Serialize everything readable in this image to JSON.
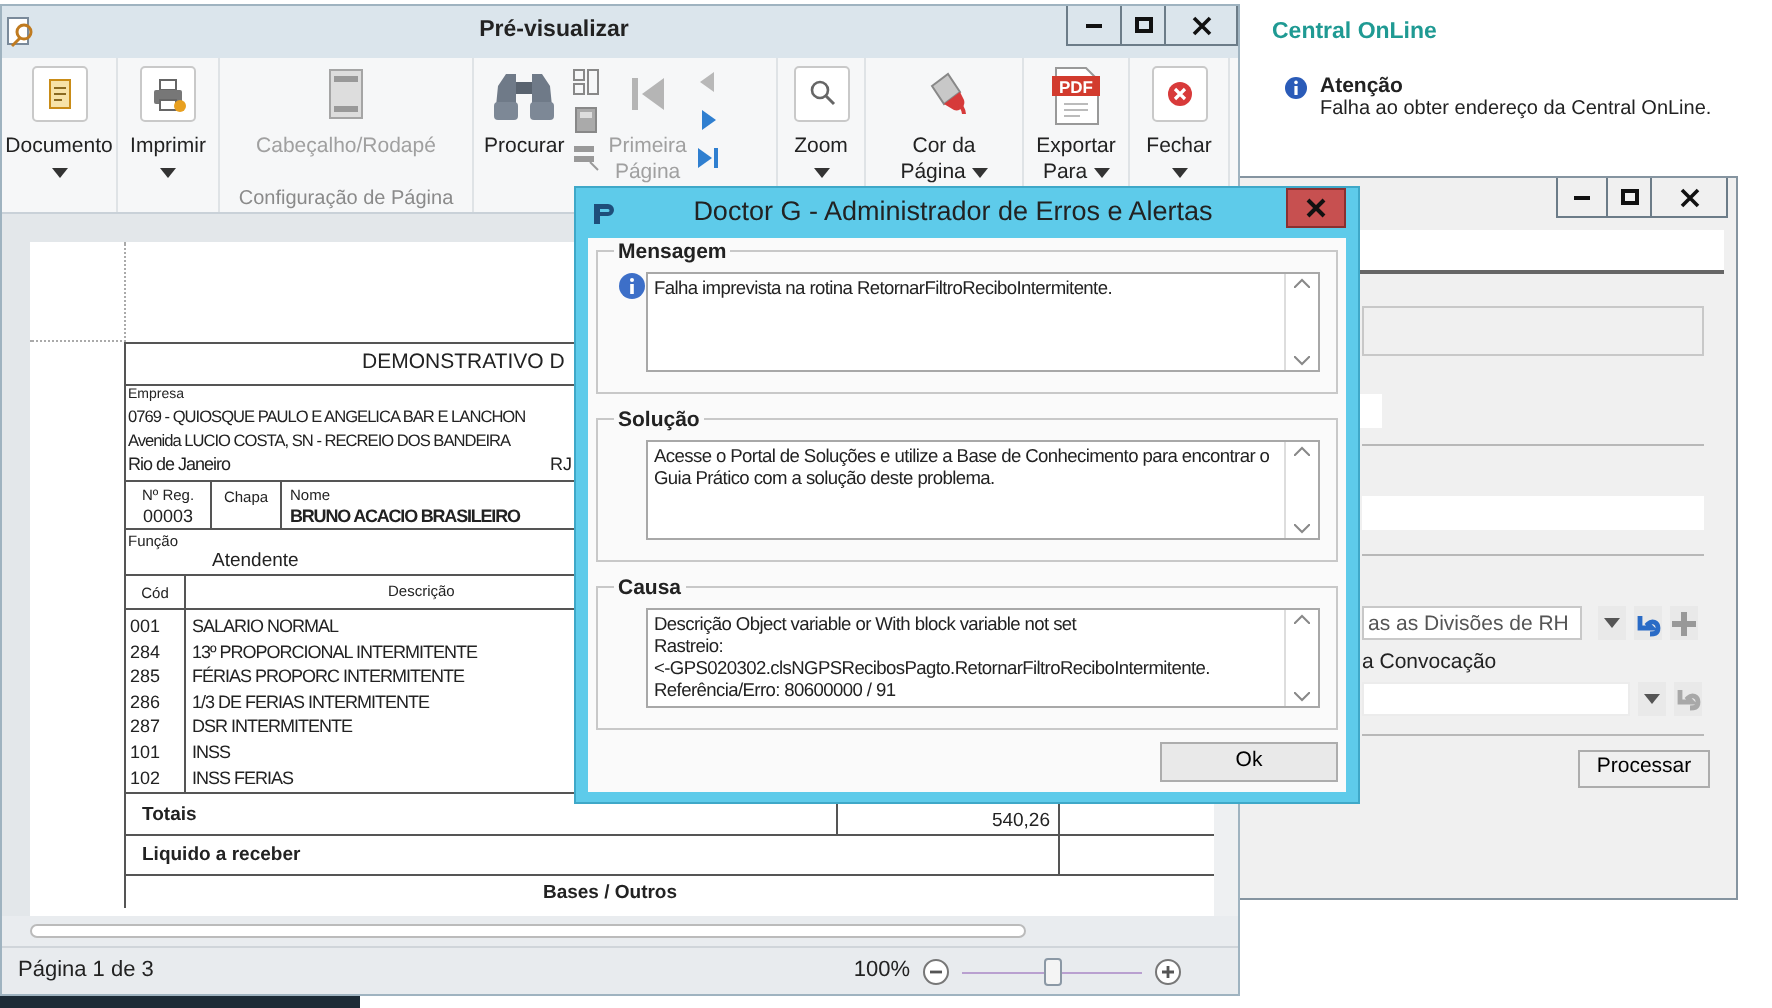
{
  "preview_window": {
    "title": "Pré-visualizar",
    "ribbon": [
      {
        "items": [
          {
            "kind": "document",
            "label": "Documento",
            "disabled": false,
            "dropdown": true
          }
        ]
      },
      {
        "items": [
          {
            "kind": "print",
            "label": "Imprimir",
            "disabled": false,
            "dropdown": true
          }
        ]
      },
      {
        "caption": "Configuração de Página",
        "items": [
          {
            "kind": "header",
            "label": "Cabeçalho/Rodapé",
            "disabled": true,
            "dropdown": false
          }
        ]
      },
      {
        "items": [
          {
            "kind": "find",
            "label": "Procurar",
            "disabled": false,
            "dropdown": false
          },
          {
            "kind": "stack",
            "buttons": [
              {
                "kind": "thumbnails"
              },
              {
                "kind": "bookmark"
              },
              {
                "kind": "multipage"
              }
            ]
          },
          {
            "kind": "first",
            "label": "Primeira Página",
            "disabled": true,
            "dropdown": false
          },
          {
            "kind": "stack",
            "buttons": [
              {
                "kind": "prev",
                "disabled": true
              },
              {
                "kind": "next",
                "disabled": false
              },
              {
                "kind": "last",
                "disabled": false
              }
            ]
          }
        ]
      },
      {
        "items": [
          {
            "kind": "zoom",
            "label": "Zoom",
            "disabled": false,
            "dropdown": true
          }
        ]
      },
      {
        "items": [
          {
            "kind": "color",
            "label": "Cor da Página",
            "disabled": false,
            "dropdown": true
          }
        ]
      },
      {
        "items": [
          {
            "kind": "export",
            "label": "Exportar Para",
            "icon_text": "PDF",
            "disabled": false,
            "dropdown": true
          }
        ]
      },
      {
        "items": [
          {
            "kind": "close",
            "label": "Fechar",
            "disabled": false,
            "dropdown": true
          }
        ]
      }
    ],
    "document": {
      "title": "DEMONSTRATIVO D",
      "company_label": "Empresa",
      "company_lines": [
        "0769 - QUIOSQUE PAULO E ANGELICA BAR E LANCHON",
        "Avenida LUCIO COSTA, SN - RECREIO DOS BANDEIRA",
        "Rio de Janeiro"
      ],
      "state": "RJ",
      "reg_label": "Nº Reg.",
      "reg": "00003",
      "chapa_label": "Chapa",
      "name_label": "Nome",
      "name": "BRUNO ACACIO BRASILEIRO",
      "function_label": "Função",
      "function": "Atendente",
      "columns": [
        "Cód",
        "Descrição"
      ],
      "rows": [
        {
          "code": "001",
          "description": "SALARIO  NORMAL"
        },
        {
          "code": "284",
          "description": "13º PROPORCIONAL INTERMITENTE"
        },
        {
          "code": "285",
          "description": "FÉRIAS PROPORC INTERMITENTE"
        },
        {
          "code": "286",
          "description": "1/3 DE FERIAS INTERMITENTE"
        },
        {
          "code": "287",
          "description": "DSR INTERMITENTE"
        },
        {
          "code": "101",
          "description": "INSS"
        },
        {
          "code": "102",
          "description": "INSS FERIAS"
        }
      ],
      "totals_label": "Totais",
      "total_earnings": "540,26",
      "net_label": "Liquido a receber",
      "bases_title": "Bases / Outros"
    },
    "status_bar": {
      "page": "Página 1 de 3",
      "zoom": "100%",
      "zoom_slider": {
        "level": 0.5
      }
    }
  },
  "notification": {
    "title": "Central OnLine",
    "heading": "Atenção",
    "message": "Falha ao obter endereço da Central OnLine."
  },
  "back_window": {
    "division_value": "as as Divisões de RH",
    "convocation_label": "a Convocação",
    "process_button": "Processar"
  },
  "dialog": {
    "title": "Doctor G - Administrador de Erros e Alertas",
    "sections": [
      {
        "kind": "info",
        "title": "Mensagem",
        "lines": [
          "Falha imprevista na rotina RetornarFiltroReciboIntermitente."
        ]
      },
      {
        "kind": "plain",
        "title": "Solução",
        "lines": [
          "Acesse o Portal de Soluções e utilize a Base de Conhecimento para encontrar o",
          "Guia Prático com a solução deste problema."
        ]
      },
      {
        "kind": "plain",
        "title": "Causa",
        "lines": [
          "Descrição Object variable or With block variable not set",
          "Rastreio:",
          "<-GPS020302.clsNGPSRecibosPagto.RetornarFiltroReciboIntermitente.",
          "Referência/Erro: 80600000 / 91"
        ]
      }
    ],
    "ok_button": "Ok"
  }
}
